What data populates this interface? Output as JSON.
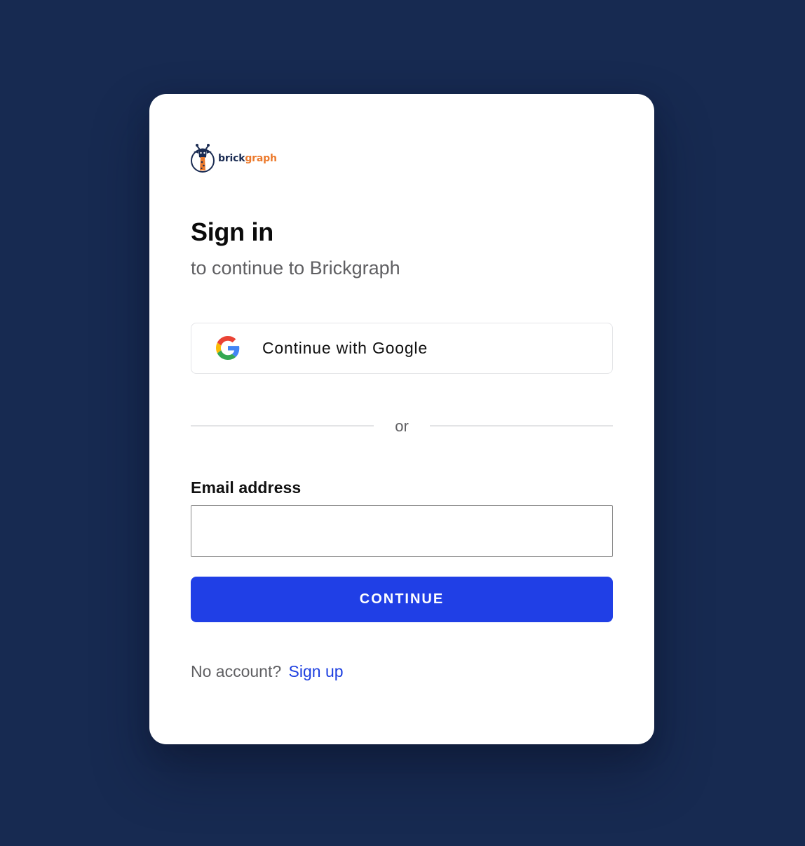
{
  "brand": {
    "logo_word_part1": "brick",
    "logo_word_part2": "graph",
    "logo_icon": "giraffe-logo-icon",
    "primary_color": "#1b2c53",
    "accent_color": "#ec7a2c"
  },
  "signin": {
    "title": "Sign in",
    "subtitle": "to continue to Brickgraph"
  },
  "google": {
    "label": "Continue with Google",
    "icon": "google-icon"
  },
  "divider": {
    "text": "or"
  },
  "email": {
    "label": "Email address",
    "value": "",
    "placeholder": ""
  },
  "continue_button": {
    "label": "CONTINUE",
    "color": "#203fe6"
  },
  "footer": {
    "prompt": "No account?",
    "link": "Sign up"
  },
  "colors": {
    "background": "#172a51",
    "card": "#ffffff",
    "link": "#1d3fe0"
  }
}
